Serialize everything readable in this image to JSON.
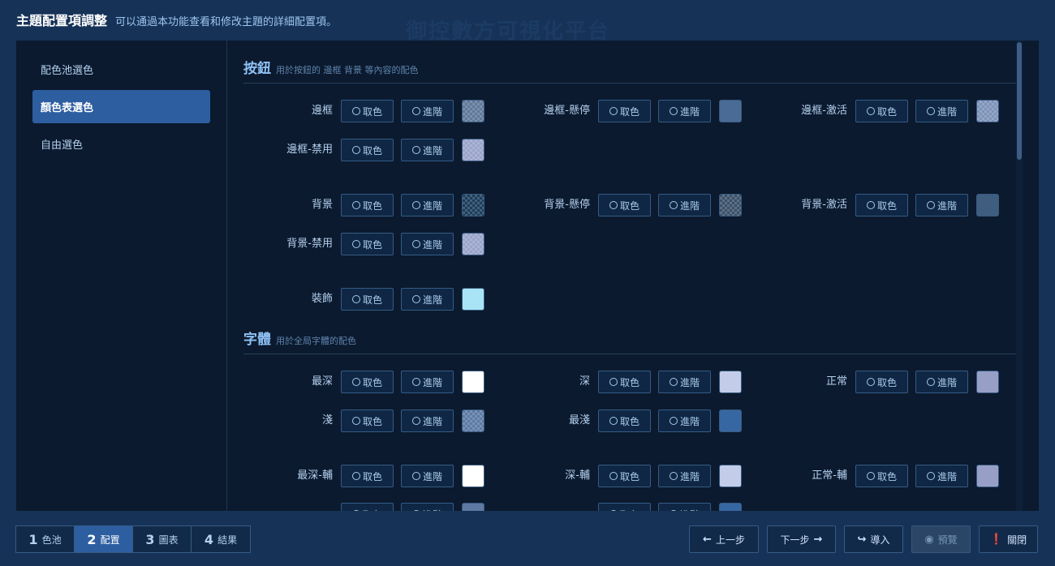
{
  "header": {
    "title": "主題配置項調整",
    "desc": "可以通過本功能查看和修改主題的詳細配置項。"
  },
  "watermark": "御控數方可視化平台",
  "sidebar": {
    "items": [
      {
        "label": "配色池選色",
        "active": false
      },
      {
        "label": "顏色表選色",
        "active": true
      },
      {
        "label": "自由選色",
        "active": false
      }
    ]
  },
  "buttons": {
    "pick": "取色",
    "advanced": "進階"
  },
  "sections": [
    {
      "title": "按鈕",
      "desc": "用於按鈕的 邊框 背景 等內容的配色"
    },
    {
      "title": "字體",
      "desc": "用於全局字體的配色"
    }
  ],
  "rows": [
    {
      "label": "邊框",
      "swatch": "#5f7899",
      "pattern": true
    },
    {
      "label": "邊框-懸停",
      "swatch": "#4a6b96",
      "pattern": false
    },
    {
      "label": "邊框-激活",
      "swatch": "#7d93b8",
      "pattern": true
    },
    {
      "label": "邊框-禁用",
      "swatch": "#9aa4cb",
      "pattern": true
    },
    {
      "label": "背景",
      "swatch": "#1b3d5c",
      "pattern": true
    },
    {
      "label": "背景-懸停",
      "swatch": "#3a5169",
      "pattern": true
    },
    {
      "label": "背景-激活",
      "swatch": "#3f5d7e",
      "pattern": false
    },
    {
      "label": "背景-禁用",
      "swatch": "#9aa4cb",
      "pattern": true
    },
    {
      "label": "裝飾",
      "swatch": "#a8e4f5",
      "pattern": false
    },
    {
      "label": "最深",
      "swatch": "#ffffff",
      "pattern": false
    },
    {
      "label": "深",
      "swatch": "#c3cdea",
      "pattern": false
    },
    {
      "label": "正常",
      "swatch": "#989fc7",
      "pattern": false
    },
    {
      "label": "淺",
      "swatch": "#5c7aa3",
      "pattern": true
    },
    {
      "label": "最淺",
      "swatch": "#3767a3",
      "pattern": false
    },
    {
      "label": "最深-輔",
      "swatch": "#ffffff",
      "pattern": false
    },
    {
      "label": "深-輔",
      "swatch": "#c3cdea",
      "pattern": false
    },
    {
      "label": "正常-輔",
      "swatch": "#989fc7",
      "pattern": false
    },
    {
      "label": "",
      "swatch": "#5c7aa3",
      "pattern": false
    },
    {
      "label": "",
      "swatch": "#3767a3",
      "pattern": false
    }
  ],
  "footer": {
    "tabs": [
      {
        "num": "1",
        "label": "色池",
        "active": false
      },
      {
        "num": "2",
        "label": "配置",
        "active": true
      },
      {
        "num": "3",
        "label": "圖表",
        "active": false
      },
      {
        "num": "4",
        "label": "結果",
        "active": false
      }
    ],
    "prev": "上一步",
    "next": "下一步",
    "import": "導入",
    "preview": "預覽",
    "close": "關閉",
    "icons": {
      "prev": "arrow-left-icon",
      "next": "arrow-right-icon",
      "import": "import-icon",
      "preview": "eye-icon",
      "close": "alert-icon"
    }
  }
}
